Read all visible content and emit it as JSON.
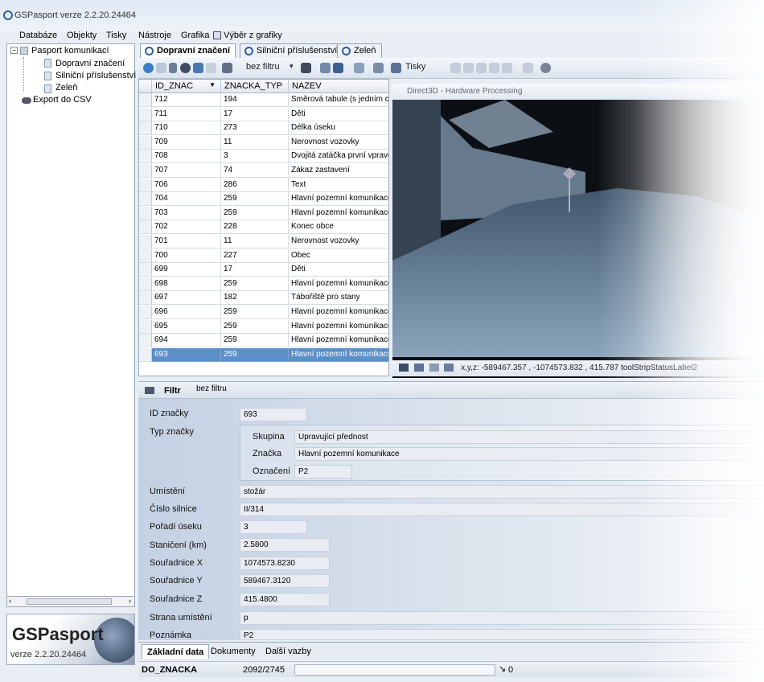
{
  "app": {
    "title": "GSPasport  verze 2.2.20.24464"
  },
  "menu": [
    "Databáze",
    "Objekty",
    "Tisky",
    "Nástroje",
    "Grafika",
    "Výběr z grafiky"
  ],
  "tree": {
    "root": "Pasport komunikací",
    "children": [
      "Dopravní značení",
      "Silniční příslušenství",
      "Zeleň"
    ],
    "export": "Export do CSV"
  },
  "logo": {
    "name": "GSPasport",
    "version": "verze 2.2.20.24464"
  },
  "tabs": [
    "Dopravní značení",
    "Silniční příslušenství",
    "Zeleň"
  ],
  "toolbar": {
    "filter_label": "bez filtru",
    "print_label": "Tisky"
  },
  "grid": {
    "columns": [
      "ID_ZNAC",
      "ZNACKA_TYP",
      "NAZEV"
    ],
    "rows": [
      [
        "712",
        "194",
        "Směrová tabule (s jedním cí..."
      ],
      [
        "711",
        "17",
        "Děti"
      ],
      [
        "710",
        "273",
        "Délka úseku"
      ],
      [
        "709",
        "11",
        "Nerovnost vozovky"
      ],
      [
        "708",
        "3",
        "Dvojitá zatáčka první vpravo"
      ],
      [
        "707",
        "74",
        "Zákaz zastavení"
      ],
      [
        "706",
        "286",
        "Text"
      ],
      [
        "704",
        "259",
        "Hlavní pozemní komunikace"
      ],
      [
        "703",
        "259",
        "Hlavní pozemní komunikace"
      ],
      [
        "702",
        "228",
        "Konec obce"
      ],
      [
        "701",
        "11",
        "Nerovnost vozovky"
      ],
      [
        "700",
        "227",
        "Obec"
      ],
      [
        "699",
        "17",
        "Děti"
      ],
      [
        "698",
        "259",
        "Hlavní pozemní komunikace"
      ],
      [
        "697",
        "182",
        "Tábořiště pro stany"
      ],
      [
        "696",
        "259",
        "Hlavní pozemní komunikace"
      ],
      [
        "695",
        "259",
        "Hlavní pozemní komunikace"
      ],
      [
        "694",
        "259",
        "Hlavní pozemní komunikace"
      ],
      [
        "693",
        "259",
        "Hlavní pozemní komunikace"
      ]
    ],
    "selected_row": 18
  },
  "view3d": {
    "title": "Direct3D - Hardware Processing",
    "status": "x,y,z: -589467.357 , -1074573.832 , 415.787  toolStripStatusLabel2"
  },
  "filter": {
    "label": "Filtr",
    "value": "bez filtru"
  },
  "form": {
    "id_label": "ID značky",
    "id_value": "693",
    "type_label": "Typ značky",
    "group_label": "Skupina",
    "group_value": "Upravující přednost",
    "sign_label": "Značka",
    "sign_value": "Hlavní pozemní komunikace",
    "mark_label": "Označení",
    "mark_value": "P2",
    "place_label": "Umístění",
    "place_value": "stožár",
    "road_label": "Číslo silnice",
    "road_value": "II/314",
    "order_label": "Pořadí úseku",
    "order_value": "3",
    "chain_label": "Staničení (km)",
    "chain_value": "2.5800",
    "x_label": "Souřadnice X",
    "x_value": "1074573.8230",
    "y_label": "Souřadnice Y",
    "y_value": "589467.3120",
    "z_label": "Souřadnice Z",
    "z_value": "415.4800",
    "side_label": "Strana umístění",
    "side_value": "p",
    "note_label": "Poznámka",
    "note_value": "P2"
  },
  "bottom_tabs": [
    "Základní data",
    "Dokumenty",
    "Další vazby"
  ],
  "status": {
    "table": "DO_ZNACKA",
    "position": "2092/2745",
    "count": "0"
  }
}
